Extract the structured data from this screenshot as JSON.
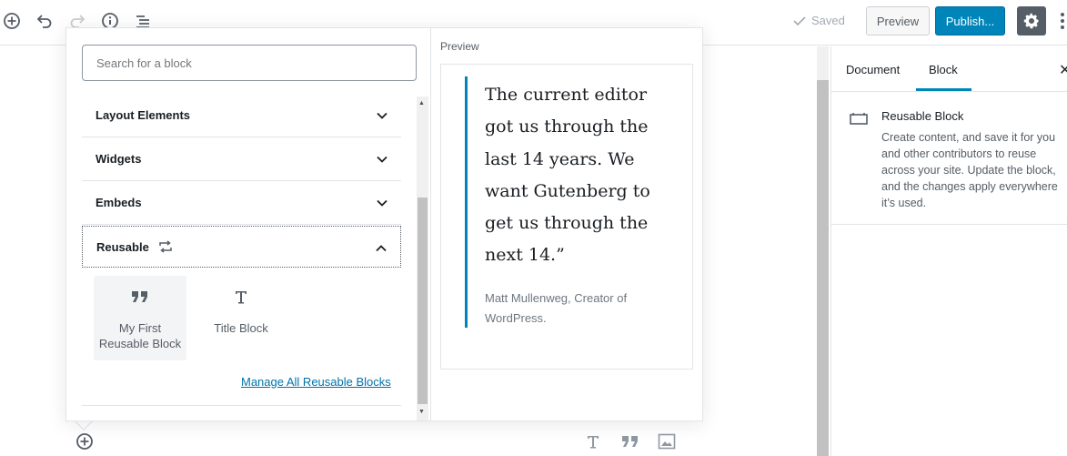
{
  "topbar": {
    "saved_label": "Saved",
    "preview_label": "Preview",
    "publish_label": "Publish...",
    "colors": {
      "primary": "#0085ba",
      "settings_bg": "#555d66"
    }
  },
  "inserter": {
    "search_placeholder": "Search for a block",
    "categories": [
      {
        "label": "Layout Elements"
      },
      {
        "label": "Widgets"
      },
      {
        "label": "Embeds"
      },
      {
        "label": "Reusable"
      }
    ],
    "reusable_blocks": [
      {
        "label": "My First Reusable Block",
        "icon": "quote-icon"
      },
      {
        "label": "Title Block",
        "icon": "heading-icon"
      }
    ],
    "manage_link": "Manage All Reusable Blocks",
    "preview": {
      "label": "Preview",
      "quote": "The current editor got us through the last 14 years. We want Gutenberg to get us through the next 14.”",
      "citation": "Matt Mullenweg, Creator of WordPress."
    }
  },
  "sidebar": {
    "tabs": [
      {
        "label": "Document"
      },
      {
        "label": "Block"
      }
    ],
    "active_tab": "Block",
    "block": {
      "title": "Reusable Block",
      "description": "Create content, and save it for you and other contributors to reuse across your site. Update the block, and the changes apply everywhere it’s used."
    }
  }
}
